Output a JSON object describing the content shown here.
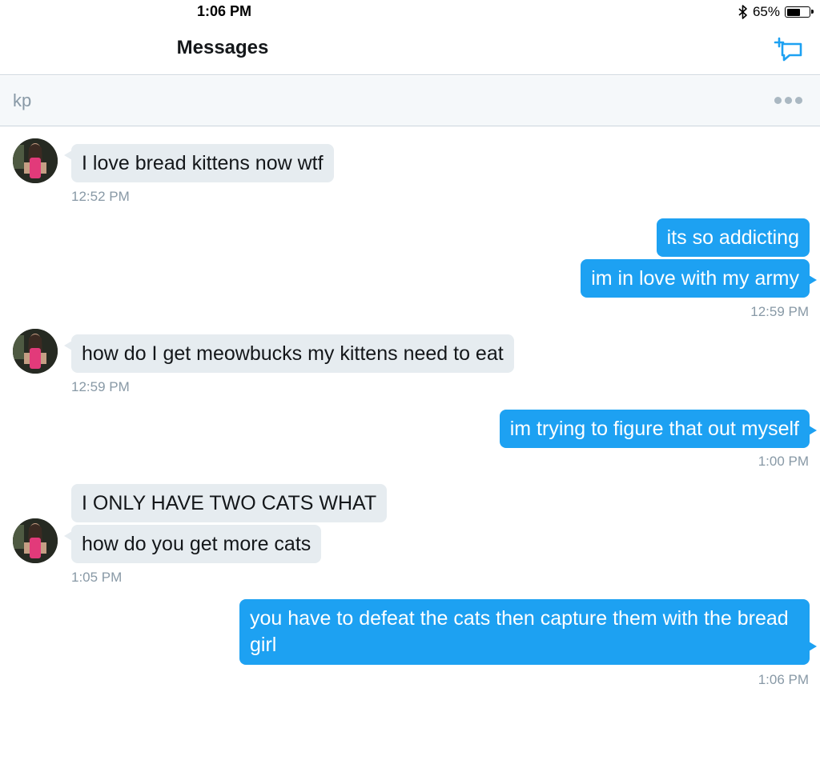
{
  "status_bar": {
    "time": "1:06 PM",
    "battery_percent": "65%",
    "battery_level": 0.65,
    "bluetooth_icon": "bluetooth-icon"
  },
  "nav": {
    "title": "Messages",
    "compose_icon": "compose-dm-icon"
  },
  "conversation": {
    "name": "kp",
    "more_icon": "more-dots-icon"
  },
  "colors": {
    "sent_bubble": "#1da1f2",
    "received_bubble": "#e6ecf0",
    "timestamp": "#8899a6"
  },
  "messages": [
    {
      "direction": "received",
      "text": "I love bread kittens now wtf"
    },
    {
      "direction": "received",
      "timestamp": "12:52 PM"
    },
    {
      "direction": "sent",
      "text": "its so addicting"
    },
    {
      "direction": "sent",
      "text": "im in love with my army"
    },
    {
      "direction": "sent",
      "timestamp": "12:59 PM"
    },
    {
      "direction": "received",
      "text": "how do I get meowbucks my kittens need to eat"
    },
    {
      "direction": "received",
      "timestamp": "12:59 PM"
    },
    {
      "direction": "sent",
      "text": "im trying to figure that out myself"
    },
    {
      "direction": "sent",
      "timestamp": "1:00 PM"
    },
    {
      "direction": "received",
      "text": "I ONLY HAVE TWO CATS WHAT"
    },
    {
      "direction": "received",
      "text": "how do you get more cats"
    },
    {
      "direction": "received",
      "timestamp": "1:05 PM"
    },
    {
      "direction": "sent",
      "text": "you have to defeat the cats then capture them with the bread girl"
    },
    {
      "direction": "sent",
      "timestamp": "1:06 PM"
    }
  ]
}
